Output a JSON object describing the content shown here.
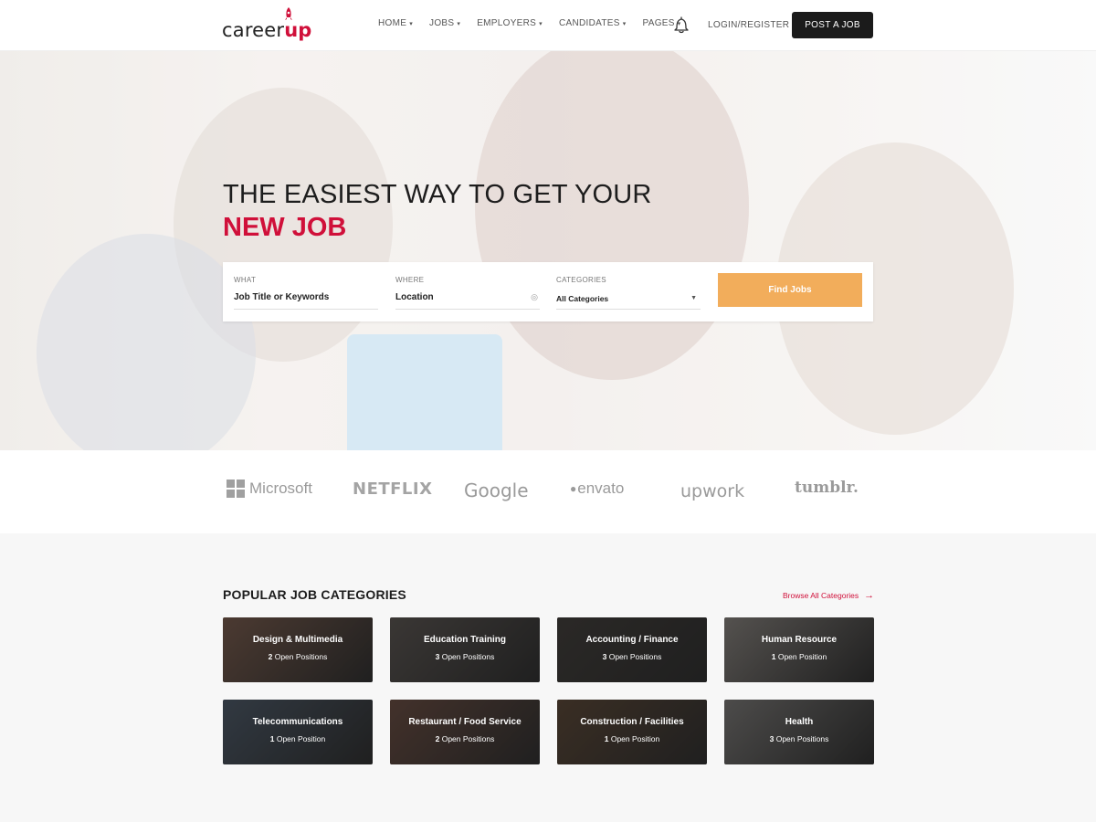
{
  "header": {
    "logo_text": "career",
    "logo_accent": "up",
    "nav": [
      {
        "label": "HOME"
      },
      {
        "label": "JOBS"
      },
      {
        "label": "EMPLOYERS"
      },
      {
        "label": "CANDIDATES"
      },
      {
        "label": "PAGES"
      }
    ],
    "login_label": "LOGIN/REGISTER",
    "post_job_label": "POST A JOB"
  },
  "hero": {
    "title_line1": "THE EASIEST WAY TO GET YOUR",
    "title_line2": "NEW JOB",
    "search": {
      "what_label": "WHAT",
      "what_value": "Job Title or Keywords",
      "where_label": "WHERE",
      "where_value": "Location",
      "categories_label": "CATEGORIES",
      "categories_value": "All Categories",
      "find_label": "Find Jobs"
    }
  },
  "brands": [
    "Microsoft",
    "NETFLIX",
    "Google",
    "envato",
    "upwork",
    "tumblr."
  ],
  "categories": {
    "title": "POPULAR JOB CATEGORIES",
    "browse_label": "Browse All Categories",
    "items": [
      {
        "name": "Design & Multimedia",
        "count": "2",
        "suffix": "Open Positions",
        "color": "#7a5a4a"
      },
      {
        "name": "Education Training",
        "count": "3",
        "suffix": "Open Positions",
        "color": "#5a5450"
      },
      {
        "name": "Accounting / Finance",
        "count": "3",
        "suffix": "Open Positions",
        "color": "#3e3a36"
      },
      {
        "name": "Human Resource",
        "count": "1",
        "suffix": "Open Position",
        "color": "#8a8580"
      },
      {
        "name": "Telecommunications",
        "count": "1",
        "suffix": "Open Position",
        "color": "#4a5868"
      },
      {
        "name": "Restaurant / Food Service",
        "count": "2",
        "suffix": "Open Positions",
        "color": "#6a4a3e"
      },
      {
        "name": "Construction / Facilities",
        "count": "1",
        "suffix": "Open Position",
        "color": "#5a4432"
      },
      {
        "name": "Health",
        "count": "3",
        "suffix": "Open Positions",
        "color": "#7c7a78"
      }
    ]
  },
  "colors": {
    "accent": "#d0103a",
    "button_orange": "#f2ad5b",
    "dark": "#1b1b1b"
  }
}
